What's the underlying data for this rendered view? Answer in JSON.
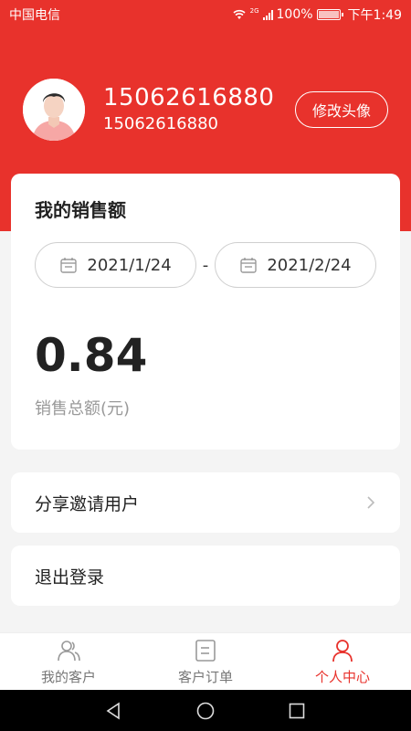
{
  "status": {
    "carrier": "中国电信",
    "network_badge": "2G",
    "battery": "100%",
    "time": "下午1:49"
  },
  "profile": {
    "phone": "15062616880",
    "phone_sub": "15062616880",
    "change_avatar_label": "修改头像"
  },
  "sales": {
    "title": "我的销售额",
    "start_date": "2021/1/24",
    "separator": "-",
    "end_date": "2021/2/24",
    "total": "0.84",
    "total_label": "销售总额(元)"
  },
  "menu": {
    "share_label": "分享邀请用户",
    "logout_label": "退出登录"
  },
  "tabs": [
    {
      "label": "我的客户",
      "icon": "customers-icon"
    },
    {
      "label": "客户订单",
      "icon": "orders-icon"
    },
    {
      "label": "个人中心",
      "icon": "profile-icon"
    }
  ],
  "colors": {
    "brand_red": "#e8322c",
    "background": "#f4f4f4"
  }
}
